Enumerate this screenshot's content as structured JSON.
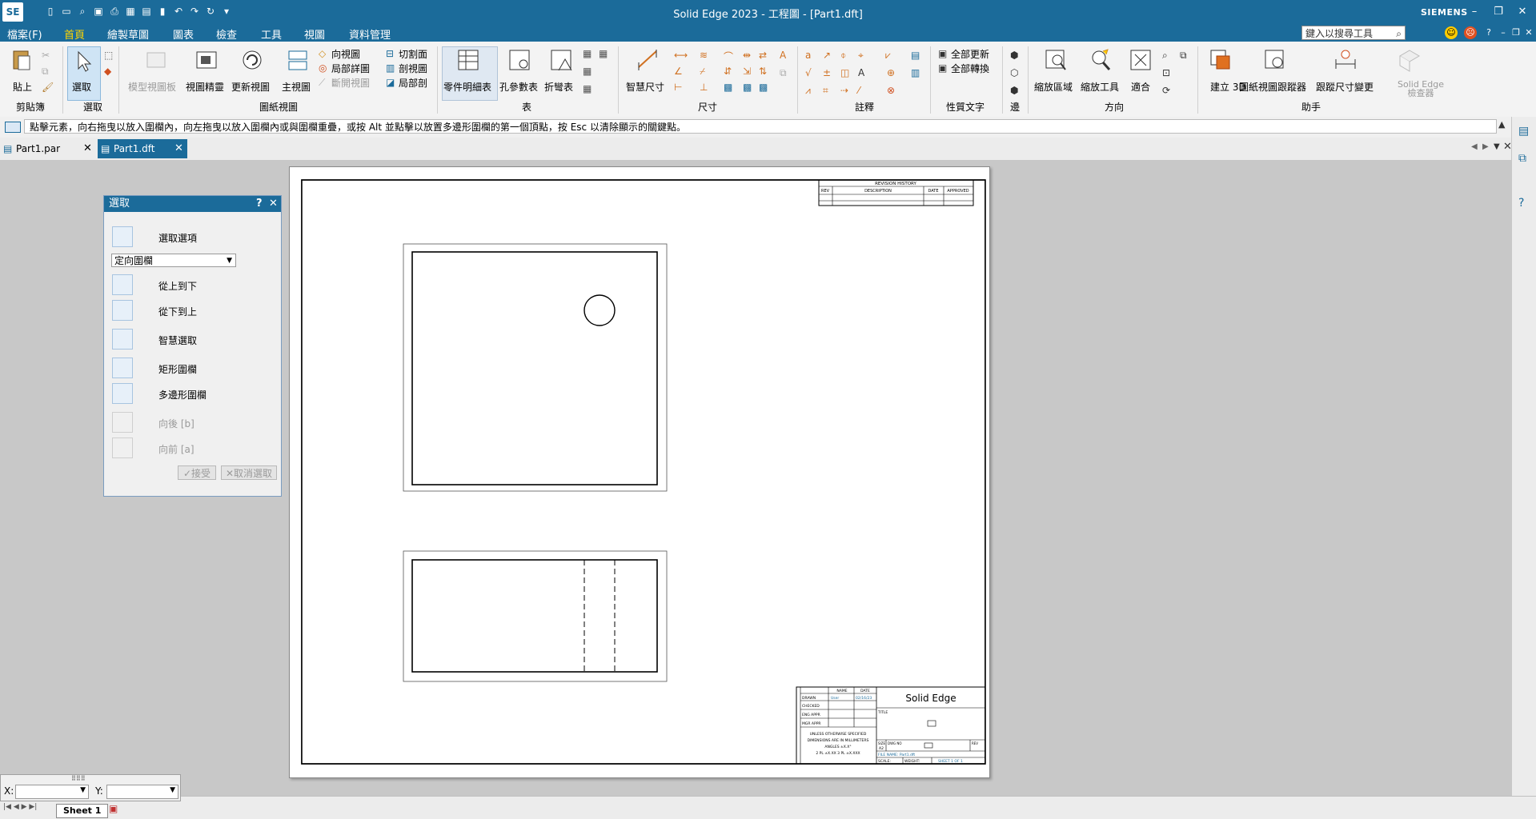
{
  "app": {
    "title": "Solid Edge 2023 - 工程圖 - [Part1.dft]",
    "logo": "SE",
    "brand": "SIEMENS",
    "accent_color": "#1b6b9a"
  },
  "window_controls": [
    "minimize-icon",
    "restore-icon",
    "close-icon"
  ],
  "menubar": {
    "items": [
      "檔案(F)",
      "首頁",
      "繪製草圖",
      "圖表",
      "檢查",
      "工具",
      "視圖",
      "資料管理"
    ],
    "active": "首頁",
    "search_placeholder": "鍵入以搜尋工具",
    "help": "?"
  },
  "ribbon": {
    "clipboard": {
      "paste": "貼上",
      "group": "剪貼簿"
    },
    "select": {
      "select": "選取",
      "group": "選取"
    },
    "drawing_views": {
      "view_wizard_dim": "模型視圖板",
      "view_wizard": "視圖精靈",
      "update_views": "更新視圖",
      "principal_view": "主視圖",
      "auxiliary": "向視圖",
      "detail": "局部詳圖",
      "broken": "斷開視圖",
      "section_plane": "切割面",
      "section": "剖視圖",
      "broken_out": "局部剖",
      "group": "圖紙視圖"
    },
    "tables": {
      "parts_list": "零件明細表",
      "hole_table": "孔參數表",
      "bend_table": "折彎表",
      "group": "表"
    },
    "dimension": {
      "smart_dimension": "智慧尺寸",
      "group": "尺寸"
    },
    "annotation": {
      "group": "註釋"
    },
    "property_text": {
      "update_all": "全部更新",
      "convert_all": "全部轉換",
      "group": "性質文字"
    },
    "edges": {
      "group": "邊"
    },
    "orient": {
      "zoom_area": "縮放區域",
      "zoom": "縮放工具",
      "fit": "適合",
      "group": "方向"
    },
    "assistants": {
      "create_3d": "建立 3D",
      "view_tracker": "圖紙視圖跟蹤器",
      "dim_tracker": "跟蹤尺寸變更",
      "inspector": "Solid Edge 檢查器",
      "group": "助手"
    }
  },
  "command_prompt": "點擊元素，向右拖曳以放入圍欄內，向左拖曳以放入圍欄內或與圍欄重疊，或按 Alt 並點擊以放置多邊形圍欄的第一個頂點，按 Esc 以清除顯示的關鍵點。",
  "tabs": [
    {
      "label": "Part1.par",
      "active": false
    },
    {
      "label": "Part1.dft",
      "active": true
    }
  ],
  "select_panel": {
    "title": "選取",
    "options_label": "選取選項",
    "dropdown_value": "定向圍欄",
    "items": [
      {
        "label": "從上到下",
        "enabled": true
      },
      {
        "label": "從下到上",
        "enabled": true
      },
      {
        "label": "智慧選取",
        "enabled": true
      },
      {
        "label": "矩形圍欄",
        "enabled": true
      },
      {
        "label": "多邊形圍欄",
        "enabled": true
      },
      {
        "label": "向後 [b]",
        "enabled": false
      },
      {
        "label": "向前 [a]",
        "enabled": false
      }
    ],
    "accept": "接受",
    "deselect": "取消選取"
  },
  "drawing": {
    "revision_history": "REVISION HISTORY",
    "rev_headers": [
      "REV",
      "DESCRIPTION",
      "DATE",
      "APPROVED"
    ],
    "title_block": {
      "company": "Solid Edge",
      "rows": [
        "DRAWN",
        "CHECKED",
        "ENG APPR",
        "MGR APPR"
      ],
      "name_header": "NAME",
      "date_header": "DATE",
      "drawn_name": "User",
      "drawn_date": "02/16/23",
      "notes": [
        "UNLESS OTHERWISE SPECIFIED",
        "DIMENSIONS ARE IN MILLIMETERS",
        "ANGLES ±X.X°",
        "2 PL ±X.XX  3 PL ±X.XXX"
      ],
      "title_label": "TITLE",
      "size_label": "SIZE",
      "size_value": "A2",
      "dwg_label": "DWG NO",
      "rev_label": "REV",
      "file_name": "FILE NAME: Part1.dft",
      "scale": "SCALE:",
      "weight": "WEIGHT:",
      "sheet": "SHEET 1 OF 1"
    }
  },
  "status": {
    "x_label": "X:",
    "y_label": "Y:",
    "sheet_tab": "Sheet 1"
  }
}
